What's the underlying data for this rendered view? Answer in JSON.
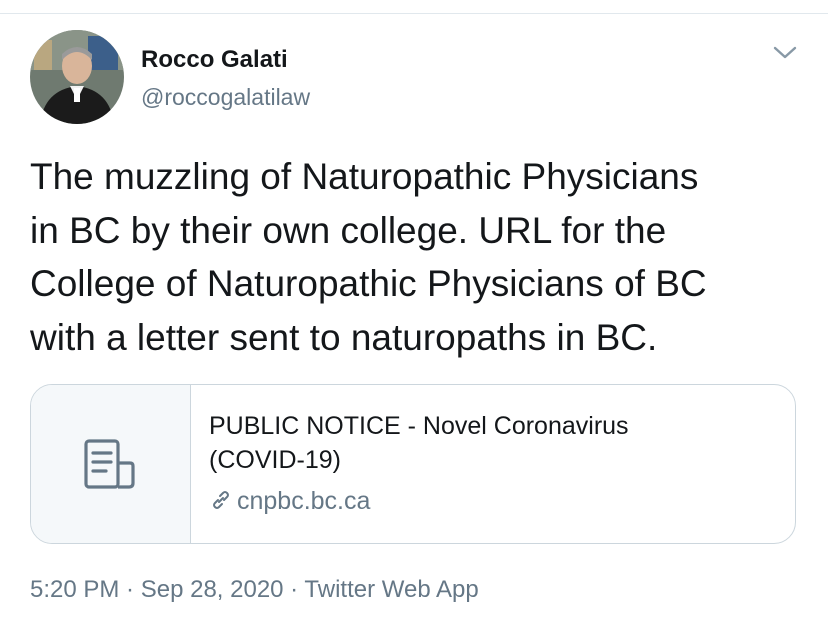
{
  "tweet": {
    "author": {
      "name": "Rocco Galati",
      "handle": "@roccogalatilaw"
    },
    "text_lines": [
      "The muzzling of Naturopathic Physicians",
      "in BC by their own college. URL for the",
      "College of Naturopathic Physicians of BC",
      "with a letter sent to naturopaths in BC."
    ],
    "card": {
      "title_lines": [
        "PUBLIC NOTICE - Novel Coronavirus",
        "(COVID-19)"
      ],
      "domain": "cnpbc.bc.ca",
      "thumbnail_icon": "document-icon"
    },
    "meta": {
      "time": "5:20 PM",
      "separator_1": " · ",
      "date": "Sep 28, 2020",
      "separator_2": " · ",
      "source": "Twitter Web App"
    }
  },
  "colors": {
    "text": "#14171a",
    "secondary": "#657786",
    "border": "#ccd6dd",
    "card_thumb_bg": "#f5f8fa"
  }
}
